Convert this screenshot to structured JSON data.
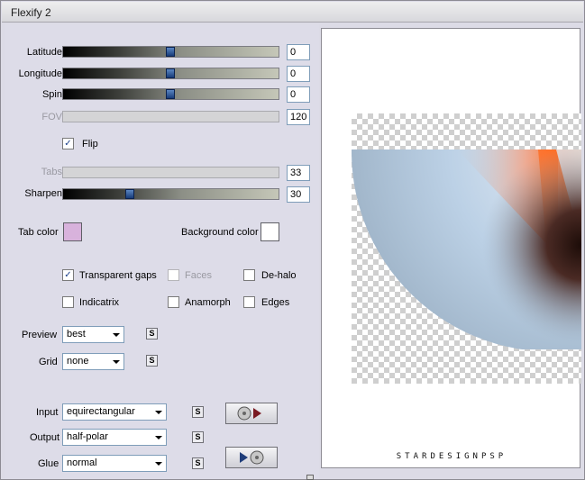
{
  "window": {
    "title": "Flexify 2"
  },
  "sliders": [
    {
      "label": "Latitude",
      "value": "0",
      "level": 0.5,
      "disabled": false
    },
    {
      "label": "Longitude",
      "value": "0",
      "level": 0.5,
      "disabled": false
    },
    {
      "label": "Spin",
      "value": "0",
      "level": 0.5,
      "disabled": false
    },
    {
      "label": "FOV",
      "value": "120",
      "level": null,
      "disabled": true
    }
  ],
  "flip": {
    "label": "Flip",
    "checked": true
  },
  "tabs": {
    "label": "Tabs",
    "value": "33",
    "disabled": true
  },
  "sharpen": {
    "label": "Sharpen",
    "value": "30",
    "level": 0.3
  },
  "tab_color": {
    "label": "Tab color",
    "color": "#d8b2dc"
  },
  "background_color": {
    "label": "Background color",
    "color": "#ffffff"
  },
  "options": {
    "transparent_gaps": {
      "label": "Transparent gaps",
      "checked": true
    },
    "faces": {
      "label": "Faces",
      "checked": false,
      "disabled": true
    },
    "de_halo": {
      "label": "De-halo",
      "checked": false
    },
    "indicatrix": {
      "label": "Indicatrix",
      "checked": false
    },
    "anamorph": {
      "label": "Anamorph",
      "checked": false
    },
    "edges": {
      "label": "Edges",
      "checked": false
    }
  },
  "preview": {
    "label": "Preview",
    "value": "best"
  },
  "grid": {
    "label": "Grid",
    "value": "none"
  },
  "input": {
    "label": "Input",
    "value": "equirectangular"
  },
  "output": {
    "label": "Output",
    "value": "half-polar"
  },
  "glue": {
    "label": "Glue",
    "value": "normal"
  },
  "s_label": "S",
  "watermark": "STARDESIGNPSP",
  "colors": {
    "accent_orange": "#ff6a1e",
    "sky_blue": "#b8d2ea",
    "dark_brown": "#2a1410"
  }
}
